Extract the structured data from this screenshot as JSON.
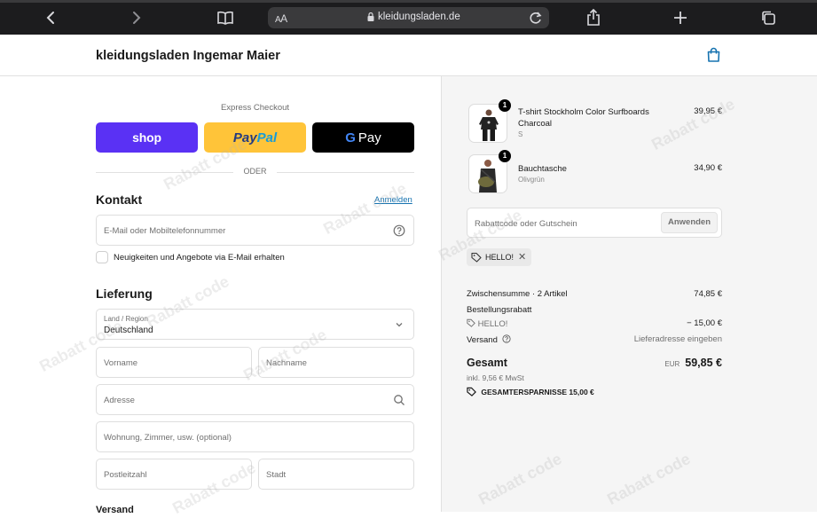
{
  "browser": {
    "aa_small": "A",
    "aa_big": "A",
    "url": "kleidungsladen.de",
    "icons": [
      "back-icon",
      "forward-icon",
      "bookmarks-icon",
      "share-icon",
      "new-tab-icon",
      "tabs-icon",
      "reload-icon",
      "lock-icon"
    ]
  },
  "header": {
    "title": "kleidungsladen Ingemar Maier",
    "cart_icon": "bag-icon"
  },
  "express": {
    "label": "Express Checkout",
    "shop_label": "shop",
    "paypal_part1": "Pay",
    "paypal_part2": "Pal",
    "gpay_g": "G",
    "gpay_label": "Pay",
    "divider": "ODER",
    "colors": {
      "shop": "#5a31f4",
      "paypal": "#ffc439",
      "gpay": "#000000"
    }
  },
  "contact": {
    "title": "Kontakt",
    "login_link": "Anmelden",
    "email_placeholder": "E-Mail oder Mobiltelefonnummer",
    "newsletter_label": "Neuigkeiten und Angebote via E-Mail erhalten"
  },
  "delivery": {
    "title": "Lieferung",
    "country_label": "Land / Region",
    "country_value": "Deutschland",
    "firstname_placeholder": "Vorname",
    "lastname_placeholder": "Nachname",
    "address_placeholder": "Adresse",
    "apartment_placeholder": "Wohnung, Zimmer, usw. (optional)",
    "zip_placeholder": "Postleitzahl",
    "city_placeholder": "Stadt",
    "shipping_title": "Versand"
  },
  "cart": {
    "items": [
      {
        "quantity": "1",
        "name": "T-shirt Stockholm Color Surfboards Charcoal",
        "variant": "S",
        "price": "39,95 €"
      },
      {
        "quantity": "1",
        "name": "Bauchtasche",
        "variant": "Olivgrün",
        "price": "34,90 €"
      }
    ],
    "discount_placeholder": "Rabattcode oder Gutschein",
    "apply_label": "Anwenden",
    "applied_code": "HELLO!"
  },
  "summary": {
    "subtotal_label": "Zwischensumme · 2 Artikel",
    "subtotal_value": "74,85 €",
    "order_discount_label": "Bestellungsrabatt",
    "discount_code": "HELLO!",
    "discount_value": "− 15,00 €",
    "shipping_label": "Versand",
    "shipping_value": "Lieferadresse eingeben",
    "total_label": "Gesamt",
    "currency": "EUR",
    "total_value": "59,85 €",
    "tax_note": "inkl. 9,56 € MwSt",
    "savings_label": "GESAMTERSPARNISSE",
    "savings_value": "15,00 €"
  },
  "watermark": "Rabatt code"
}
